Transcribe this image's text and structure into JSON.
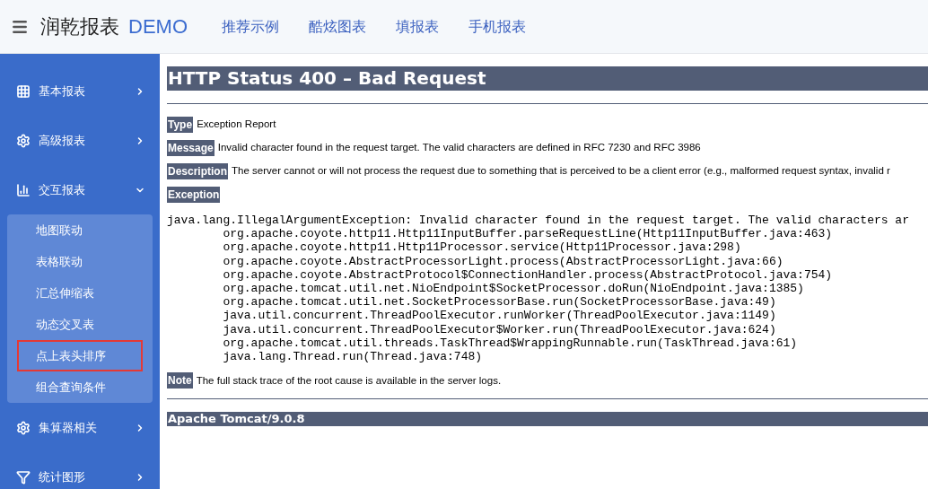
{
  "header": {
    "brand": "润乾报表",
    "brand_suffix": "DEMO",
    "nav": [
      {
        "label": "推荐示例"
      },
      {
        "label": "酷炫图表"
      },
      {
        "label": "填报表"
      },
      {
        "label": "手机报表"
      }
    ]
  },
  "sidebar": {
    "items": [
      {
        "label": "基本报表",
        "kind": "grid",
        "expanded": false
      },
      {
        "label": "高级报表",
        "kind": "gears",
        "expanded": false
      },
      {
        "label": "交互报表",
        "kind": "chart",
        "expanded": true,
        "children": [
          {
            "label": "地图联动",
            "selected": false
          },
          {
            "label": "表格联动",
            "selected": false
          },
          {
            "label": "汇总伸缩表",
            "selected": false
          },
          {
            "label": "动态交叉表",
            "selected": false
          },
          {
            "label": "点上表头排序",
            "selected": true
          },
          {
            "label": "组合查询条件",
            "selected": false
          }
        ]
      },
      {
        "label": "集算器相关",
        "kind": "gears",
        "expanded": false
      },
      {
        "label": "统计图形",
        "kind": "filter",
        "expanded": false
      }
    ]
  },
  "error_page": {
    "title": "HTTP Status 400 – Bad Request",
    "fields": [
      {
        "label": "Type",
        "text": "Exception Report"
      },
      {
        "label": "Message",
        "text": "Invalid character found in the request target. The valid characters are defined in RFC 7230 and RFC 3986"
      },
      {
        "label": "Description",
        "text": "The server cannot or will not process the request due to something that is perceived to be a client error (e.g., malformed request syntax, invalid r"
      },
      {
        "label": "Exception"
      }
    ],
    "stack_trace": [
      "java.lang.IllegalArgumentException: Invalid character found in the request target. The valid characters ar",
      "org.apache.coyote.http11.Http11InputBuffer.parseRequestLine(Http11InputBuffer.java:463)",
      "org.apache.coyote.http11.Http11Processor.service(Http11Processor.java:298)",
      "org.apache.coyote.AbstractProcessorLight.process(AbstractProcessorLight.java:66)",
      "org.apache.coyote.AbstractProtocol$ConnectionHandler.process(AbstractProtocol.java:754)",
      "org.apache.tomcat.util.net.NioEndpoint$SocketProcessor.doRun(NioEndpoint.java:1385)",
      "org.apache.tomcat.util.net.SocketProcessorBase.run(SocketProcessorBase.java:49)",
      "java.util.concurrent.ThreadPoolExecutor.runWorker(ThreadPoolExecutor.java:1149)",
      "java.util.concurrent.ThreadPoolExecutor$Worker.run(ThreadPoolExecutor.java:624)",
      "org.apache.tomcat.util.threads.TaskThread$WrappingRunnable.run(TaskThread.java:61)",
      "java.lang.Thread.run(Thread.java:748)"
    ],
    "note": {
      "label": "Note",
      "text": "The full stack trace of the root cause is available in the server logs."
    },
    "footer": "Apache Tomcat/9.0.8"
  }
}
